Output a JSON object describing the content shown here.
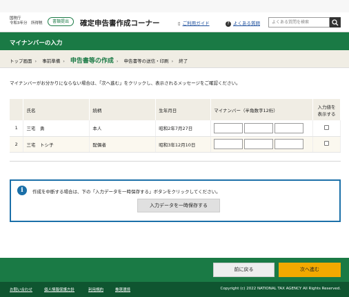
{
  "header": {
    "agency_line1": "国税庁",
    "agency_line2": "令和3年分　所得税",
    "badge": "書類提出",
    "title": "確定申告書作成コーナー",
    "guide_link": "ご利用ガイド",
    "faq_link": "よくある質問",
    "search_placeholder": "よくある質問を検索"
  },
  "page_title": "マイナンバーの入力",
  "breadcrumb": [
    "トップ画面",
    "事前準備",
    "申告書等の作成",
    "申告書等の送信・印刷",
    "終了"
  ],
  "instruction": "マイナンバーがお分かりにならない場合は、「次へ進む」をクリックし、表示されるメッセージをご確認ください。",
  "table": {
    "headers": [
      "氏名",
      "続柄",
      "生年月日",
      "マイナンバー（半角数字12桁）",
      "入力値を表示する"
    ],
    "rows": [
      {
        "num": "1",
        "name": "三宅　勇",
        "relation": "本人",
        "birth": "昭和2年7月27日"
      },
      {
        "num": "2",
        "name": "三宅　トシ子",
        "relation": "配偶者",
        "birth": "昭和3年12月10日"
      }
    ]
  },
  "notice": {
    "text": "作成を中断する場合は、下の「入力データを一時保存する」ボタンをクリックしてください。",
    "save_button": "入力データを一時保存する"
  },
  "nav": {
    "back": "前に戻る",
    "next": "次へ進む"
  },
  "footer": {
    "links": [
      "お問い合わせ",
      "個人情報保護方針",
      "利用規約",
      "推奨環境"
    ],
    "copyright": "Copyright (c) 2022 NATIONAL TAX AGENCY All Rights Reserved."
  },
  "colors": {
    "brand_green": "#1a7a45",
    "next_button": "#f2a900",
    "info_blue": "#1a6fa8"
  }
}
